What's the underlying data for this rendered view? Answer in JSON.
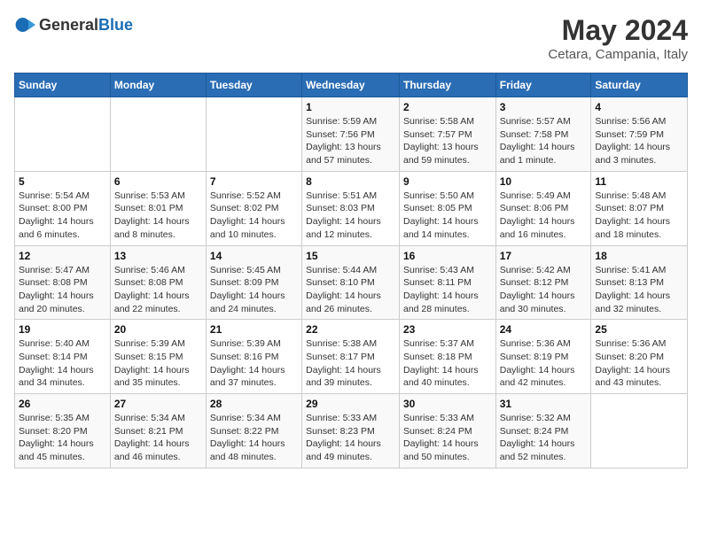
{
  "logo": {
    "general": "General",
    "blue": "Blue"
  },
  "title": "May 2024",
  "subtitle": "Cetara, Campania, Italy",
  "header_days": [
    "Sunday",
    "Monday",
    "Tuesday",
    "Wednesday",
    "Thursday",
    "Friday",
    "Saturday"
  ],
  "weeks": [
    [
      {
        "day": "",
        "info": ""
      },
      {
        "day": "",
        "info": ""
      },
      {
        "day": "",
        "info": ""
      },
      {
        "day": "1",
        "info": "Sunrise: 5:59 AM\nSunset: 7:56 PM\nDaylight: 13 hours\nand 57 minutes."
      },
      {
        "day": "2",
        "info": "Sunrise: 5:58 AM\nSunset: 7:57 PM\nDaylight: 13 hours\nand 59 minutes."
      },
      {
        "day": "3",
        "info": "Sunrise: 5:57 AM\nSunset: 7:58 PM\nDaylight: 14 hours\nand 1 minute."
      },
      {
        "day": "4",
        "info": "Sunrise: 5:56 AM\nSunset: 7:59 PM\nDaylight: 14 hours\nand 3 minutes."
      }
    ],
    [
      {
        "day": "5",
        "info": "Sunrise: 5:54 AM\nSunset: 8:00 PM\nDaylight: 14 hours\nand 6 minutes."
      },
      {
        "day": "6",
        "info": "Sunrise: 5:53 AM\nSunset: 8:01 PM\nDaylight: 14 hours\nand 8 minutes."
      },
      {
        "day": "7",
        "info": "Sunrise: 5:52 AM\nSunset: 8:02 PM\nDaylight: 14 hours\nand 10 minutes."
      },
      {
        "day": "8",
        "info": "Sunrise: 5:51 AM\nSunset: 8:03 PM\nDaylight: 14 hours\nand 12 minutes."
      },
      {
        "day": "9",
        "info": "Sunrise: 5:50 AM\nSunset: 8:05 PM\nDaylight: 14 hours\nand 14 minutes."
      },
      {
        "day": "10",
        "info": "Sunrise: 5:49 AM\nSunset: 8:06 PM\nDaylight: 14 hours\nand 16 minutes."
      },
      {
        "day": "11",
        "info": "Sunrise: 5:48 AM\nSunset: 8:07 PM\nDaylight: 14 hours\nand 18 minutes."
      }
    ],
    [
      {
        "day": "12",
        "info": "Sunrise: 5:47 AM\nSunset: 8:08 PM\nDaylight: 14 hours\nand 20 minutes."
      },
      {
        "day": "13",
        "info": "Sunrise: 5:46 AM\nSunset: 8:08 PM\nDaylight: 14 hours\nand 22 minutes."
      },
      {
        "day": "14",
        "info": "Sunrise: 5:45 AM\nSunset: 8:09 PM\nDaylight: 14 hours\nand 24 minutes."
      },
      {
        "day": "15",
        "info": "Sunrise: 5:44 AM\nSunset: 8:10 PM\nDaylight: 14 hours\nand 26 minutes."
      },
      {
        "day": "16",
        "info": "Sunrise: 5:43 AM\nSunset: 8:11 PM\nDaylight: 14 hours\nand 28 minutes."
      },
      {
        "day": "17",
        "info": "Sunrise: 5:42 AM\nSunset: 8:12 PM\nDaylight: 14 hours\nand 30 minutes."
      },
      {
        "day": "18",
        "info": "Sunrise: 5:41 AM\nSunset: 8:13 PM\nDaylight: 14 hours\nand 32 minutes."
      }
    ],
    [
      {
        "day": "19",
        "info": "Sunrise: 5:40 AM\nSunset: 8:14 PM\nDaylight: 14 hours\nand 34 minutes."
      },
      {
        "day": "20",
        "info": "Sunrise: 5:39 AM\nSunset: 8:15 PM\nDaylight: 14 hours\nand 35 minutes."
      },
      {
        "day": "21",
        "info": "Sunrise: 5:39 AM\nSunset: 8:16 PM\nDaylight: 14 hours\nand 37 minutes."
      },
      {
        "day": "22",
        "info": "Sunrise: 5:38 AM\nSunset: 8:17 PM\nDaylight: 14 hours\nand 39 minutes."
      },
      {
        "day": "23",
        "info": "Sunrise: 5:37 AM\nSunset: 8:18 PM\nDaylight: 14 hours\nand 40 minutes."
      },
      {
        "day": "24",
        "info": "Sunrise: 5:36 AM\nSunset: 8:19 PM\nDaylight: 14 hours\nand 42 minutes."
      },
      {
        "day": "25",
        "info": "Sunrise: 5:36 AM\nSunset: 8:20 PM\nDaylight: 14 hours\nand 43 minutes."
      }
    ],
    [
      {
        "day": "26",
        "info": "Sunrise: 5:35 AM\nSunset: 8:20 PM\nDaylight: 14 hours\nand 45 minutes."
      },
      {
        "day": "27",
        "info": "Sunrise: 5:34 AM\nSunset: 8:21 PM\nDaylight: 14 hours\nand 46 minutes."
      },
      {
        "day": "28",
        "info": "Sunrise: 5:34 AM\nSunset: 8:22 PM\nDaylight: 14 hours\nand 48 minutes."
      },
      {
        "day": "29",
        "info": "Sunrise: 5:33 AM\nSunset: 8:23 PM\nDaylight: 14 hours\nand 49 minutes."
      },
      {
        "day": "30",
        "info": "Sunrise: 5:33 AM\nSunset: 8:24 PM\nDaylight: 14 hours\nand 50 minutes."
      },
      {
        "day": "31",
        "info": "Sunrise: 5:32 AM\nSunset: 8:24 PM\nDaylight: 14 hours\nand 52 minutes."
      },
      {
        "day": "",
        "info": ""
      }
    ]
  ]
}
